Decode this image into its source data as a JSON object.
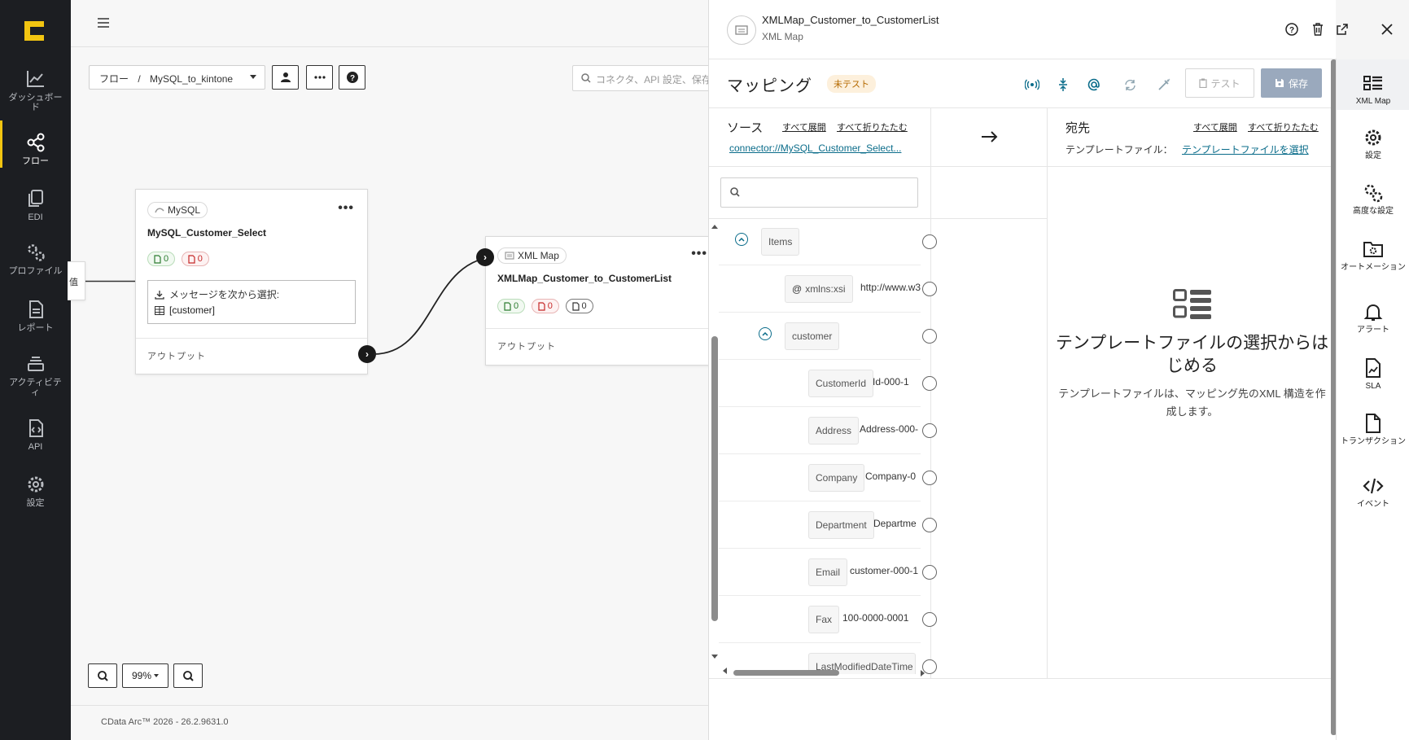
{
  "leftnav": {
    "items": [
      {
        "label": "ダッシュボード",
        "icon": "chart-line-icon"
      },
      {
        "label": "フロー",
        "icon": "share-nodes-icon"
      },
      {
        "label": "EDI",
        "icon": "copy-icon"
      },
      {
        "label": "プロファイル",
        "icon": "gears-icon"
      },
      {
        "label": "レポート",
        "icon": "file-lines-icon"
      },
      {
        "label": "アクティビティ",
        "icon": "layers-icon"
      },
      {
        "label": "API",
        "icon": "file-code-icon"
      },
      {
        "label": "設定",
        "icon": "gear-icon"
      }
    ]
  },
  "canvas": {
    "breadcrumb": {
      "root": "フロー",
      "sep": "/",
      "current": "MySQL_to_kintone"
    },
    "search_placeholder": "コネクタ、API 設定、保存",
    "left_stub": "值",
    "node1": {
      "type": "MySQL",
      "name": "MySQL_Customer_Select",
      "success": "0",
      "error": "0",
      "message_label": "メッセージを次から選択:",
      "table": "[customer]",
      "output": "アウトプット"
    },
    "node2": {
      "type": "XML Map",
      "name": "XMLMap_Customer_to_CustomerList",
      "success": "0",
      "error": "0",
      "pending": "0",
      "output": "アウトプット"
    },
    "zoom": "99%",
    "footer": "CData Arc™ 2026 - 26.2.9631.0"
  },
  "panel": {
    "title": "XMLMap_Customer_to_CustomerList",
    "subtitle": "XML Map",
    "map_title": "マッピング",
    "status_badge": "未テスト",
    "test_label": "テスト",
    "save_label": "保存",
    "source": {
      "heading": "ソース",
      "expand_all": "すべて展開",
      "collapse_all": "すべて折りたたむ",
      "link": "connector://MySQL_Customer_Select..."
    },
    "dest": {
      "heading": "宛先",
      "expand_all": "すべて展開",
      "collapse_all": "すべて折りたたむ",
      "template_label": "テンプレートファイル：",
      "template_link": "テンプレートファイルを選択",
      "empty_title": "テンプレートファイルの選択からはじめる",
      "empty_desc": "テンプレートファイルは、マッピング先のXML 構造を作成します。"
    },
    "tree": [
      {
        "label": "Items",
        "value": ""
      },
      {
        "label": "xmlns:xsi",
        "value": "http://www.w3"
      },
      {
        "label": "customer",
        "value": ""
      },
      {
        "label": "CustomerId",
        "value": "Id-000-1"
      },
      {
        "label": "Address",
        "value": "Address-000-"
      },
      {
        "label": "Company",
        "value": "Company-0"
      },
      {
        "label": "Department",
        "value": "Departme"
      },
      {
        "label": "Email",
        "value": "customer-000-1"
      },
      {
        "label": "Fax",
        "value": "100-0000-0001"
      },
      {
        "label": "LastModifiedDateTime",
        "value": ""
      }
    ]
  },
  "rail": {
    "items": [
      {
        "label": "XML Map",
        "icon": "list-layout-icon"
      },
      {
        "label": "設定",
        "icon": "gear-icon"
      },
      {
        "label": "高度な設定",
        "icon": "gears-icon"
      },
      {
        "label": "オートメーション",
        "icon": "folder-gear-icon"
      },
      {
        "label": "アラート",
        "icon": "bell-icon"
      },
      {
        "label": "SLA",
        "icon": "file-chart-icon"
      },
      {
        "label": "トランザクション",
        "icon": "file-icon"
      },
      {
        "label": "イベント",
        "icon": "code-icon"
      }
    ]
  }
}
